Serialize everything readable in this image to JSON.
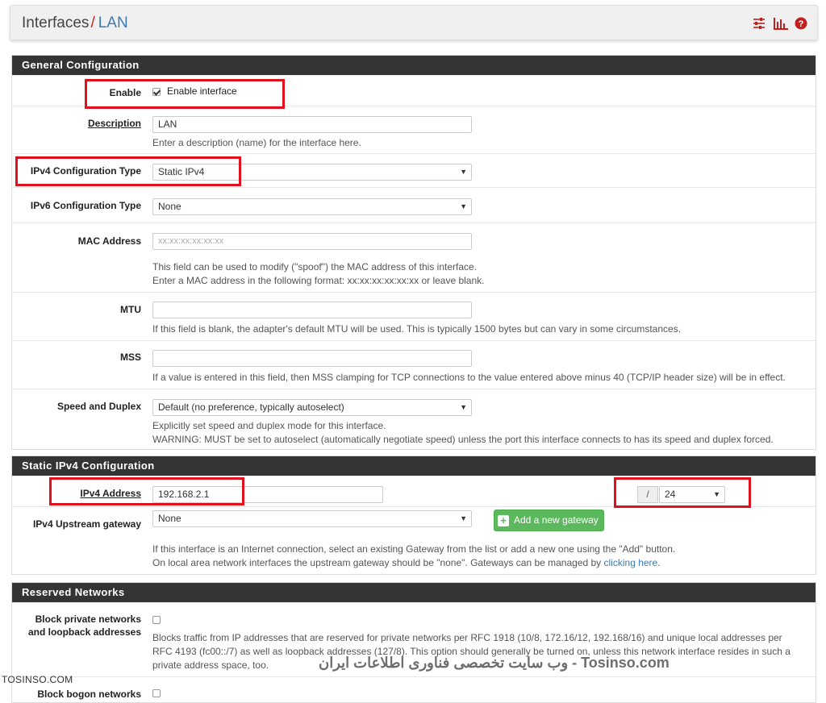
{
  "header": {
    "title": "Interfaces",
    "separator": "/",
    "crumb": "LAN"
  },
  "header_icons": [
    "sliders-icon",
    "bar-chart-icon",
    "help-icon"
  ],
  "general": {
    "heading": "General Configuration",
    "enable_label": "Enable",
    "enable_checkbox_label": "Enable interface",
    "description_label": "Description",
    "description_value": "LAN",
    "description_help": "Enter a description (name) for the interface here.",
    "ipv4_type_label": "IPv4 Configuration Type",
    "ipv4_type_value": "Static IPv4",
    "ipv6_type_label": "IPv6 Configuration Type",
    "ipv6_type_value": "None",
    "mac_label": "MAC Address",
    "mac_placeholder": "xx:xx:xx:xx:xx:xx",
    "mac_help_1": "This field can be used to modify (\"spoof\") the MAC address of this interface.",
    "mac_help_2": "Enter a MAC address in the following format: xx:xx:xx:xx:xx:xx or leave blank.",
    "mtu_label": "MTU",
    "mtu_help": "If this field is blank, the adapter's default MTU will be used. This is typically 1500 bytes but can vary in some circumstances.",
    "mss_label": "MSS",
    "mss_help": "If a value is entered in this field, then MSS clamping for TCP connections to the value entered above minus 40 (TCP/IP header size) will be in effect.",
    "speed_label": "Speed and Duplex",
    "speed_value": "Default (no preference, typically autoselect)",
    "speed_help_1": "Explicitly set speed and duplex mode for this interface.",
    "speed_help_2": "WARNING: MUST be set to autoselect (automatically negotiate speed) unless the port this interface connects to has its speed and duplex forced."
  },
  "static_ipv4": {
    "heading": "Static IPv4 Configuration",
    "address_label": "IPv4 Address",
    "address_value": "192.168.2.1",
    "slash": "/",
    "cidr_value": "24",
    "gateway_label": "IPv4 Upstream gateway",
    "gateway_value": "None",
    "add_gateway_button": "Add a new gateway",
    "gateway_help_1": "If this interface is an Internet connection, select an existing Gateway from the list or add a new one using the \"Add\" button.",
    "gateway_help_2": "On local area network interfaces the upstream gateway should be \"none\". Gateways can be managed by ",
    "gateway_help_link": "clicking here",
    "gateway_help_end": "."
  },
  "reserved": {
    "heading": "Reserved Networks",
    "private_label_1": "Block private networks",
    "private_label_2": "and loopback addresses",
    "private_help_1": "Blocks traffic from IP addresses that are reserved for private networks per RFC 1918 (10/8, 172.16/12, 192.168/16) and unique local addresses per",
    "private_help_2": "RFC 4193 (fc00::/7) as well as loopback addresses (127/8). This option should generally be turned on, unless this network interface resides in such a",
    "private_help_3": "private address space, too.",
    "bogon_label": "Block bogon networks"
  },
  "watermark": {
    "left": "TOSINSO.COM",
    "right": "وب سایت تخصصی فناوری اطلاعات ایران - Tosinso.com"
  },
  "colors": {
    "panel_head": "#343434",
    "highlight": "#e0101c",
    "link": "#3a7ab8",
    "green_button": "#5cb85c"
  }
}
